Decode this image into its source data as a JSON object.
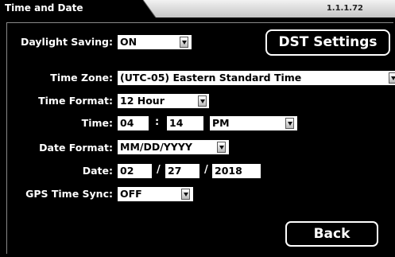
{
  "header": {
    "title": "Time and Date",
    "version": "1.1.1.72"
  },
  "dst": {
    "label": "Daylight Saving:",
    "value": "ON",
    "settings_button": "DST Settings"
  },
  "time_zone": {
    "label": "Time Zone:",
    "value": "(UTC-05) Eastern Standard Time"
  },
  "time_format": {
    "label": "Time Format:",
    "value": "12 Hour"
  },
  "time": {
    "label": "Time:",
    "hour": "04",
    "separator": ":",
    "minute": "14",
    "ampm": "PM"
  },
  "date_format": {
    "label": "Date Format:",
    "value": "MM/DD/YYYY"
  },
  "date": {
    "label": "Date:",
    "month": "02",
    "separator": "/",
    "day": "27",
    "year": "2018"
  },
  "gps_sync": {
    "label": "GPS Time Sync:",
    "value": "OFF"
  },
  "footer": {
    "back_button": "Back"
  },
  "colors": {
    "background": "#000000",
    "tab": "#000000",
    "header_bar": "#d9d9d9",
    "field": "#ffffff",
    "text": "#ffffff"
  }
}
